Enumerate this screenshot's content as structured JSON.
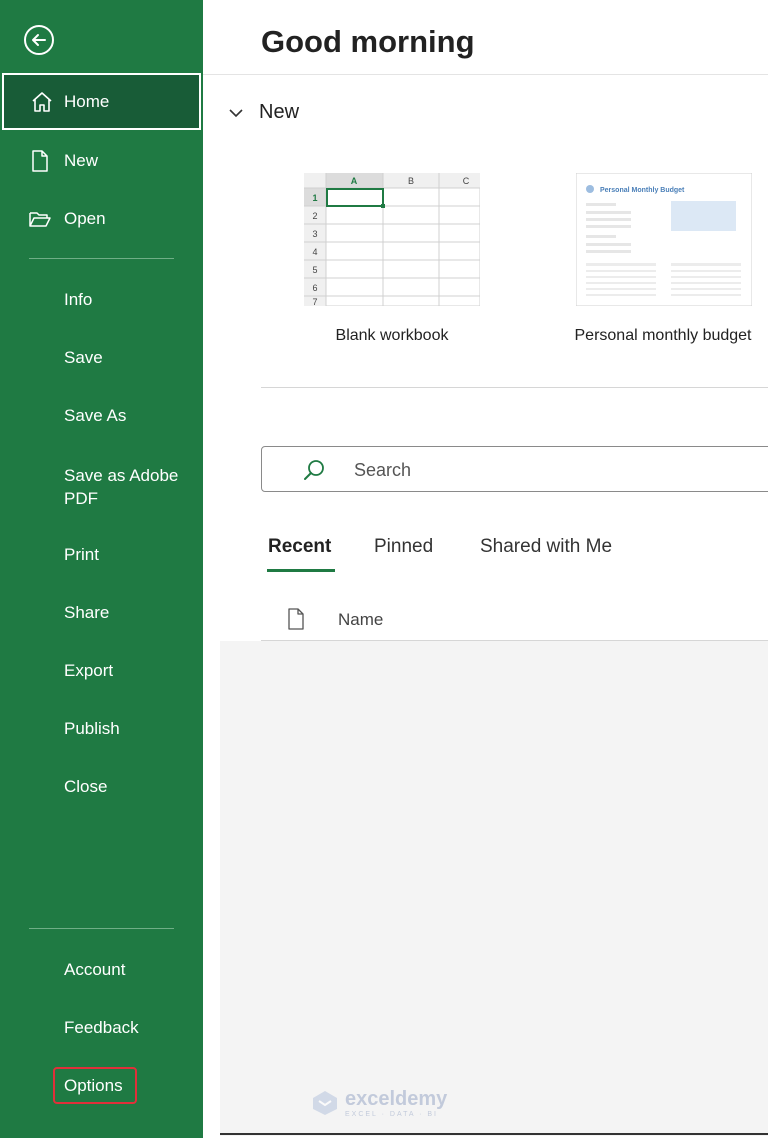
{
  "sidebar": {
    "back_icon": "back-arrow-icon",
    "items": [
      {
        "label": "Home",
        "icon": "home-icon"
      },
      {
        "label": "New",
        "icon": "new-document-icon"
      },
      {
        "label": "Open",
        "icon": "folder-open-icon"
      },
      {
        "label": "Info"
      },
      {
        "label": "Save"
      },
      {
        "label": "Save As"
      },
      {
        "label": "Save as Adobe PDF"
      },
      {
        "label": "Print"
      },
      {
        "label": "Share"
      },
      {
        "label": "Export"
      },
      {
        "label": "Publish"
      },
      {
        "label": "Close"
      },
      {
        "label": "Account"
      },
      {
        "label": "Feedback"
      },
      {
        "label": "Options"
      }
    ]
  },
  "main": {
    "greeting": "Good morning",
    "new_section": "New",
    "templates": [
      {
        "label": "Blank workbook",
        "columns": [
          "A",
          "B",
          "C"
        ],
        "rows": [
          "1",
          "2",
          "3",
          "4",
          "5",
          "6",
          "7"
        ]
      },
      {
        "label": "Personal monthly budget",
        "preview_title": "Personal Monthly Budget"
      }
    ],
    "search_placeholder": "Search",
    "tabs": [
      "Recent",
      "Pinned",
      "Shared with Me"
    ],
    "column_name": "Name"
  },
  "watermark": {
    "title": "exceldemy",
    "subtitle": "EXCEL · DATA · BI"
  },
  "colors": {
    "sidebar": "#1f7a43",
    "selected": "#185c37",
    "highlight": "#e0303a"
  }
}
